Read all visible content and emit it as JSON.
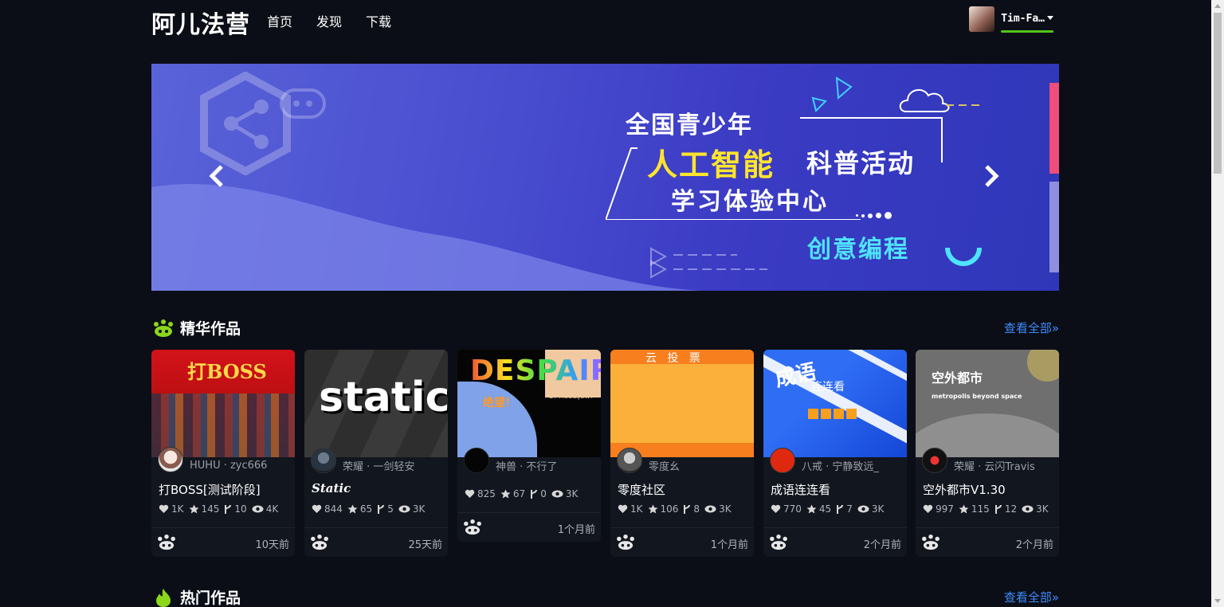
{
  "header": {
    "logo": "阿儿法营",
    "nav": [
      "首页",
      "发现",
      "下载"
    ],
    "username": "Tim-Fa…"
  },
  "banner": {
    "line1": "全国青少年",
    "line2_highlight": "人工智能",
    "line2_rest": "科普活动",
    "line3": "学习体验中心",
    "line4": "创意编程"
  },
  "featured": {
    "title": "精华作品",
    "more": "查看全部»",
    "cards": [
      {
        "thumb_text": "打BOSS",
        "author": "HUHU · zyc666",
        "title": "打BOSS[测试阶段]",
        "likes": "1K",
        "stars": "145",
        "forks": "10",
        "views": "4K",
        "time": "10天前"
      },
      {
        "thumb_text": "static",
        "author": "荣耀 · 一剑轻安",
        "title": "Static",
        "likes": "844",
        "stars": "65",
        "forks": "5",
        "views": "3K",
        "time": "25天前"
      },
      {
        "thumb_text": "DESPAIR",
        "thumb_sub": "绝望！",
        "thumb_by": "BY HuOLiJUwY",
        "author": "神兽 · 不行了",
        "title": "",
        "likes": "825",
        "stars": "67",
        "forks": "0",
        "views": "3K",
        "time": "1个月前"
      },
      {
        "thumb_text": "云   投   票",
        "author": "零度幺",
        "title": "零度社区",
        "likes": "1K",
        "stars": "106",
        "forks": "8",
        "views": "3K",
        "time": "1个月前"
      },
      {
        "thumb_text": "成语",
        "thumb_sub": "连连看",
        "author": "八戒 · 宁静致远_",
        "title": "成语连连看",
        "likes": "770",
        "stars": "45",
        "forks": "7",
        "views": "3K",
        "time": "2个月前"
      },
      {
        "thumb_text": "空外都市",
        "thumb_sub": "metropolis beyond space",
        "author": "荣耀 · 云闪Travis",
        "title": "空外都市V1.30",
        "likes": "997",
        "stars": "115",
        "forks": "12",
        "views": "3K",
        "time": "2个月前"
      }
    ]
  },
  "hot": {
    "title": "热门作品",
    "more": "查看全部»"
  },
  "colors": {
    "background": "#0b0e16",
    "accent_green": "#52c41a",
    "link_blue": "#3e8cff",
    "banner_yellow": "#ffe52e",
    "banner_cyan": "#4fe3ff"
  }
}
